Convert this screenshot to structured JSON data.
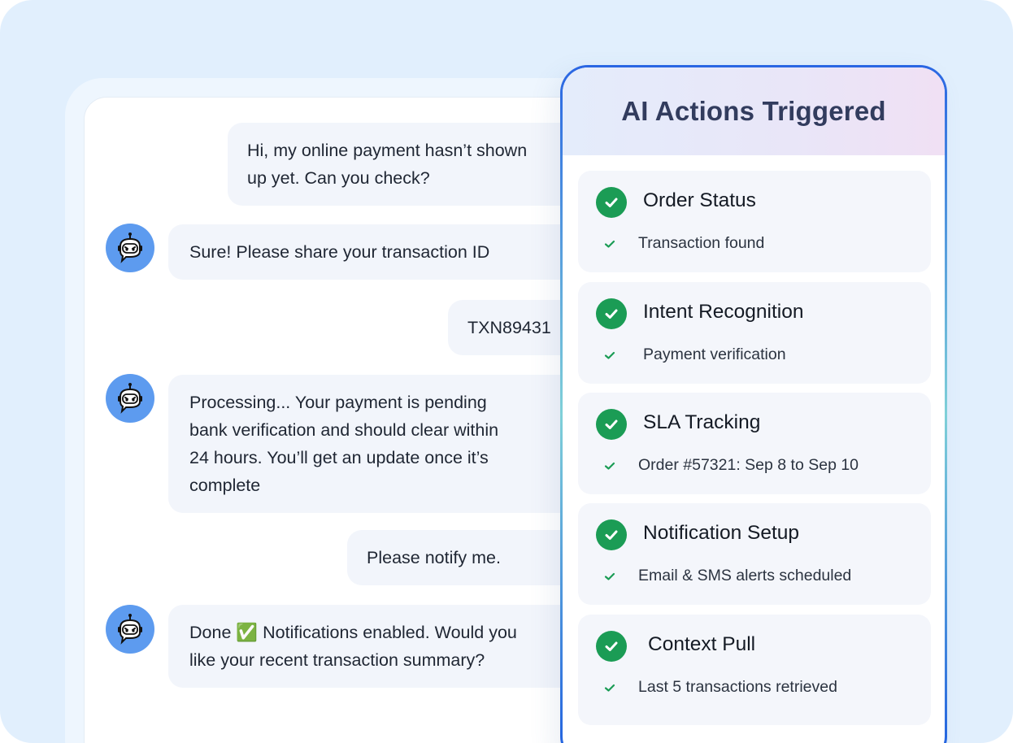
{
  "chat": {
    "messages": [
      {
        "sender": "user",
        "lines": [
          "Hi, my online payment hasn’t shown",
          "up yet. Can you check?"
        ]
      },
      {
        "sender": "bot",
        "lines": [
          "Sure! Please share your transaction ID"
        ]
      },
      {
        "sender": "user",
        "lines": [
          "TXN89431"
        ]
      },
      {
        "sender": "bot",
        "lines": [
          "Processing... Your payment is pending",
          "bank verification and should clear within",
          "24 hours. You’ll get an update once it’s",
          "complete"
        ]
      },
      {
        "sender": "user",
        "lines": [
          "Please notify me."
        ]
      },
      {
        "sender": "bot",
        "lines": [
          "Done ✅ Notifications enabled. Would you",
          "like your recent transaction summary?"
        ]
      }
    ],
    "bot_avatar_icon": "robot-icon"
  },
  "panel": {
    "title": "AI Actions Triggered",
    "actions": [
      {
        "title": "Order Status",
        "detail": "Transaction found"
      },
      {
        "title": "Intent Recognition",
        "detail": "Payment verification"
      },
      {
        "title": "SLA Tracking",
        "detail": "Order #57321: Sep 8 to Sep 10"
      },
      {
        "title": "Notification Setup",
        "detail": "Email & SMS alerts scheduled"
      },
      {
        "title": "Context Pull",
        "detail": "Last 5 transactions retrieved"
      }
    ]
  },
  "colors": {
    "background": "#e1effd",
    "bubble": "#f2f5fb",
    "avatar": "#5d9bef",
    "success": "#1b9c55",
    "panel_title": "#323c5e",
    "panel_border": "#2a66e3"
  }
}
